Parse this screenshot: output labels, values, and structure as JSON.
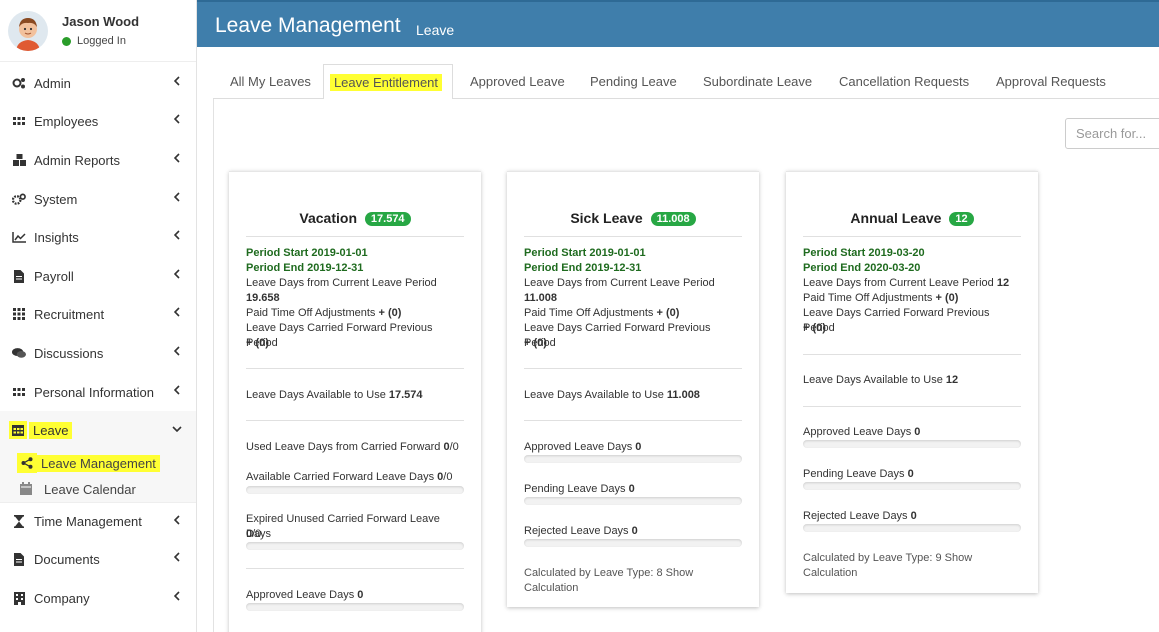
{
  "user": {
    "name": "Jason Wood",
    "status": "Logged In"
  },
  "sidebar": {
    "items": [
      {
        "label": "Admin",
        "icon": "cogs-icon"
      },
      {
        "label": "Employees",
        "icon": "grid-icon"
      },
      {
        "label": "Admin Reports",
        "icon": "cubes-icon"
      },
      {
        "label": "System",
        "icon": "gears-icon"
      },
      {
        "label": "Insights",
        "icon": "line-chart-icon"
      },
      {
        "label": "Payroll",
        "icon": "file-icon"
      },
      {
        "label": "Recruitment",
        "icon": "grid-icon"
      },
      {
        "label": "Discussions",
        "icon": "comments-icon"
      },
      {
        "label": "Personal Information",
        "icon": "grid-icon"
      },
      {
        "label": "Leave",
        "icon": "calendar-icon"
      },
      {
        "label": "Time Management",
        "icon": "hourglass-icon"
      },
      {
        "label": "Documents",
        "icon": "file-icon"
      },
      {
        "label": "Company",
        "icon": "building-icon"
      }
    ],
    "leave_sub": [
      {
        "label": "Leave Management",
        "icon": "share-icon"
      },
      {
        "label": "Leave Calendar",
        "icon": "calendar-icon"
      }
    ]
  },
  "header": {
    "title": "Leave Management",
    "subtitle": "Leave"
  },
  "tabs": [
    {
      "label": "All My Leaves"
    },
    {
      "label": "Leave Entitlement"
    },
    {
      "label": "Approved Leave"
    },
    {
      "label": "Pending Leave"
    },
    {
      "label": "Subordinate Leave"
    },
    {
      "label": "Cancellation Requests"
    },
    {
      "label": "Approval Requests"
    }
  ],
  "search": {
    "placeholder": "Search for..."
  },
  "cards": [
    {
      "title": "Vacation",
      "badge": "17.574",
      "period_start": "Period Start 2019-01-01",
      "period_end": "Period End 2019-12-31",
      "current_label": "Leave Days from Current Leave Period",
      "current_value": "19.658",
      "pto_label": "Paid Time Off Adjustments",
      "pto_value": "+ (0)",
      "cf_label": "Leave Days Carried Forward Previous Period",
      "cf_value": "+ (0)",
      "available_label": "Leave Days Available to Use",
      "available_value": "17.574",
      "used_cf_label": "Used Leave Days from Carried Forward",
      "used_cf_value": "0",
      "used_cf_total": "/0",
      "avail_cf_label": "Available Carried Forward Leave Days",
      "avail_cf_value": "0",
      "avail_cf_total": "/0",
      "expired_label": "Expired Unused Carried Forward Leave Days",
      "expired_value": "0",
      "expired_total": "/0",
      "approved_label": "Approved Leave Days",
      "approved_value": "0"
    },
    {
      "title": "Sick Leave",
      "badge": "11.008",
      "period_start": "Period Start 2019-01-01",
      "period_end": "Period End 2019-12-31",
      "current_label": "Leave Days from Current Leave Period",
      "current_value": "11.008",
      "pto_label": "Paid Time Off Adjustments",
      "pto_value": "+ (0)",
      "cf_label": "Leave Days Carried Forward Previous Period",
      "cf_value": "+ (0)",
      "available_label": "Leave Days Available to Use",
      "available_value": "11.008",
      "approved_label": "Approved Leave Days",
      "approved_value": "0",
      "pending_label": "Pending Leave Days",
      "pending_value": "0",
      "rejected_label": "Rejected Leave Days",
      "rejected_value": "0",
      "calc_text": "Calculated by Leave Type: 8 Show Calculation"
    },
    {
      "title": "Annual Leave",
      "badge": "12",
      "period_start": "Period Start 2019-03-20",
      "period_end": "Period End 2020-03-20",
      "current_label": "Leave Days from Current Leave Period",
      "current_value": "12",
      "pto_label": "Paid Time Off Adjustments",
      "pto_value": "+ (0)",
      "cf_label": "Leave Days Carried Forward Previous Period",
      "cf_value": "+ (0)",
      "available_label": "Leave Days Available to Use",
      "available_value": "12",
      "approved_label": "Approved Leave Days",
      "approved_value": "0",
      "pending_label": "Pending Leave Days",
      "pending_value": "0",
      "rejected_label": "Rejected Leave Days",
      "rejected_value": "0",
      "calc_text": "Calculated by Leave Type: 9 Show Calculation"
    }
  ],
  "colors": {
    "header": "#3f7eab",
    "badge": "#27a744",
    "highlight": "#ffff33",
    "period": "#1f6b1f"
  }
}
